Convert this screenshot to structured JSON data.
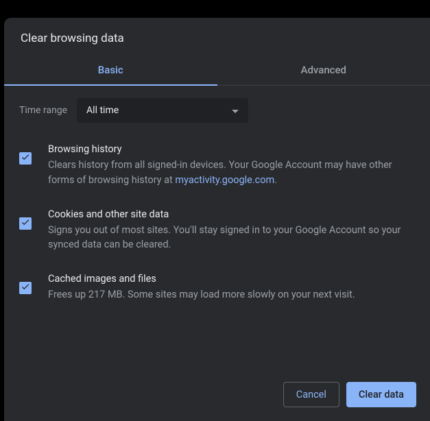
{
  "dialog": {
    "title": "Clear browsing data"
  },
  "tabs": {
    "basic": "Basic",
    "advanced": "Advanced"
  },
  "time_range": {
    "label": "Time range",
    "value": "All time"
  },
  "options": {
    "browsing_history": {
      "title": "Browsing history",
      "desc_prefix": "Clears history from all signed-in devices. Your Google Account may have other forms of browsing history at ",
      "link_text": "myactivity.google.com",
      "desc_suffix": "."
    },
    "cookies": {
      "title": "Cookies and other site data",
      "desc": "Signs you out of most sites. You'll stay signed in to your Google Account so your synced data can be cleared."
    },
    "cache": {
      "title": "Cached images and files",
      "desc": "Frees up 217 MB. Some sites may load more slowly on your next visit."
    }
  },
  "footer": {
    "cancel": "Cancel",
    "clear": "Clear data"
  }
}
